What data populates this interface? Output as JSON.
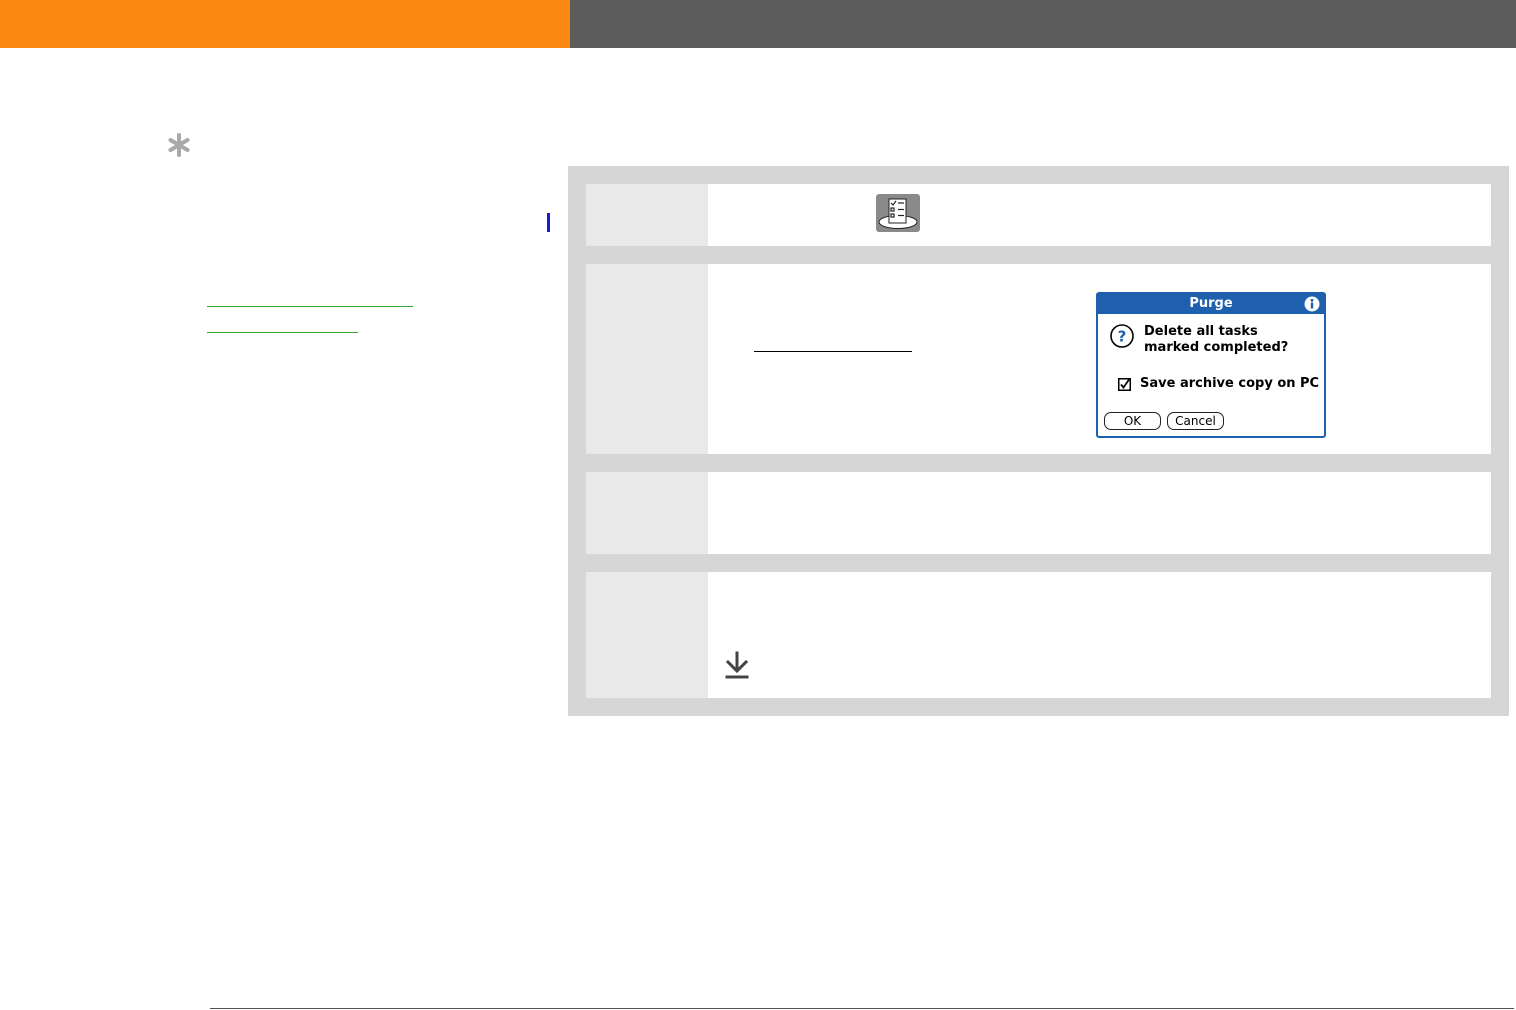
{
  "colors": {
    "header_orange": "#fb8a14",
    "header_gray": "#5d5d5d",
    "link_green": "#3aa63a",
    "dialog_blue": "#1e5fae",
    "step_panel": "#d6d6d6"
  },
  "icons": {
    "tip": "asterisk-icon",
    "app": "tasks-app-icon",
    "info": "info-icon",
    "question": "question-icon",
    "checkbox": "checkbox-checked-icon",
    "download": "download-arrow-icon"
  },
  "dialog": {
    "title": "Purge",
    "message_line1": "Delete all tasks",
    "message_line2": "marked completed?",
    "checkbox_label": "Save archive copy on PC",
    "checkbox_checked": true,
    "ok_label": "OK",
    "cancel_label": "Cancel"
  }
}
